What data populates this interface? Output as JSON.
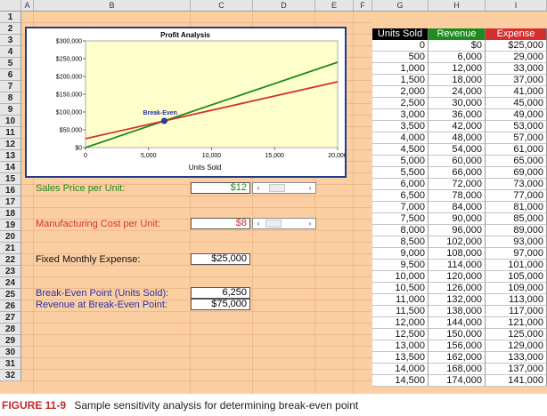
{
  "columns": [
    "A",
    "B",
    "C",
    "D",
    "E",
    "F",
    "G",
    "H",
    "I"
  ],
  "rows": [
    "1",
    "2",
    "3",
    "4",
    "5",
    "6",
    "7",
    "8",
    "9",
    "10",
    "11",
    "12",
    "13",
    "14",
    "15",
    "16",
    "17",
    "18",
    "19",
    "20",
    "21",
    "22",
    "23",
    "24",
    "25",
    "26",
    "27",
    "28",
    "29",
    "30",
    "31",
    "32"
  ],
  "chart": {
    "title": "Profit Analysis",
    "xlabel": "Units Sold",
    "annotation": "Break-Even"
  },
  "chart_data": {
    "type": "line",
    "title": "Profit Analysis",
    "xlabel": "Units Sold",
    "ylabel": "",
    "xlim": [
      0,
      20000
    ],
    "ylim": [
      0,
      300000
    ],
    "x_ticks": [
      "0",
      "5,000",
      "10,000",
      "15,000",
      "20,000"
    ],
    "y_ticks": [
      "$0",
      "$50,000",
      "$100,000",
      "$150,000",
      "$200,000",
      "$250,000",
      "$300,000"
    ],
    "series": [
      {
        "name": "Revenue",
        "color": "#1E8B1E",
        "x": [
          0,
          20000
        ],
        "y": [
          0,
          240000
        ]
      },
      {
        "name": "Expense",
        "color": "#D32F2F",
        "x": [
          0,
          20000
        ],
        "y": [
          25000,
          185000
        ]
      }
    ],
    "annotations": [
      {
        "text": "Break-Even",
        "x": 6250,
        "y": 75000
      }
    ],
    "grid": false,
    "plot_background": "#FFFFCC"
  },
  "inputs": {
    "sales_price_label": "Sales Price per Unit:",
    "sales_price_value": "$12",
    "mfg_cost_label": "Manufacturing Cost per Unit:",
    "mfg_cost_value": "$8",
    "fixed_expense_label": "Fixed Monthly Expense:",
    "fixed_expense_value": "$25,000",
    "scroll_left_glyph": "‹",
    "scroll_right_glyph": "›"
  },
  "results": {
    "bep_label": "Break-Even Point (Units Sold):",
    "bep_value": "6,250",
    "rev_label": "Revenue at Break-Even Point:",
    "rev_value": "$75,000"
  },
  "table": {
    "headers": [
      "Units Sold",
      "Revenue",
      "Expense"
    ],
    "header_colors": [
      "#000000",
      "#1E8B1E",
      "#D32F2F"
    ],
    "rows": [
      [
        "0",
        "$0",
        "$25,000"
      ],
      [
        "500",
        "6,000",
        "29,000"
      ],
      [
        "1,000",
        "12,000",
        "33,000"
      ],
      [
        "1,500",
        "18,000",
        "37,000"
      ],
      [
        "2,000",
        "24,000",
        "41,000"
      ],
      [
        "2,500",
        "30,000",
        "45,000"
      ],
      [
        "3,000",
        "36,000",
        "49,000"
      ],
      [
        "3,500",
        "42,000",
        "53,000"
      ],
      [
        "4,000",
        "48,000",
        "57,000"
      ],
      [
        "4,500",
        "54,000",
        "61,000"
      ],
      [
        "5,000",
        "60,000",
        "65,000"
      ],
      [
        "5,500",
        "66,000",
        "69,000"
      ],
      [
        "6,000",
        "72,000",
        "73,000"
      ],
      [
        "6,500",
        "78,000",
        "77,000"
      ],
      [
        "7,000",
        "84,000",
        "81,000"
      ],
      [
        "7,500",
        "90,000",
        "85,000"
      ],
      [
        "8,000",
        "96,000",
        "89,000"
      ],
      [
        "8,500",
        "102,000",
        "93,000"
      ],
      [
        "9,000",
        "108,000",
        "97,000"
      ],
      [
        "9,500",
        "114,000",
        "101,000"
      ],
      [
        "10,000",
        "120,000",
        "105,000"
      ],
      [
        "10,500",
        "126,000",
        "109,000"
      ],
      [
        "11,000",
        "132,000",
        "113,000"
      ],
      [
        "11,500",
        "138,000",
        "117,000"
      ],
      [
        "12,000",
        "144,000",
        "121,000"
      ],
      [
        "12,500",
        "150,000",
        "125,000"
      ],
      [
        "13,000",
        "156,000",
        "129,000"
      ],
      [
        "13,500",
        "162,000",
        "133,000"
      ],
      [
        "14,000",
        "168,000",
        "137,000"
      ],
      [
        "14,500",
        "174,000",
        "141,000"
      ]
    ]
  },
  "caption": {
    "figure": "FIGURE 11-9",
    "text": "Sample sensitivity analysis for determining break-even point"
  },
  "colors": {
    "sheet_bg": "#FCCFA3",
    "chart_border": "#1F3A8A",
    "sales_label": "#1E8B1E",
    "mfg_label": "#D32F2F",
    "result_label": "#2233AA"
  }
}
